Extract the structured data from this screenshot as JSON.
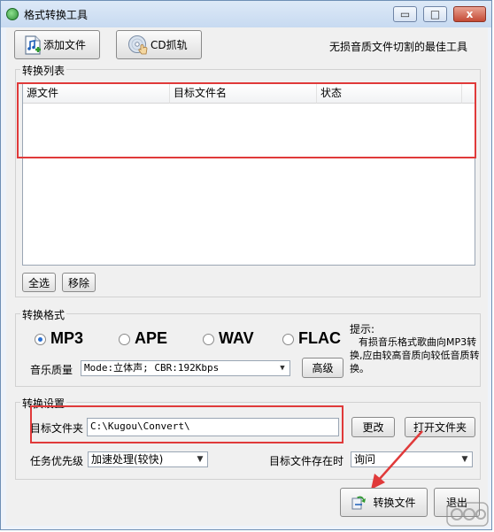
{
  "window": {
    "title": "格式转换工具",
    "min_label": "▭",
    "max_label": "□",
    "close_label": "x"
  },
  "toolbar": {
    "add_file_label": "添加文件",
    "cd_rip_label": "CD抓轨",
    "slogan": "无损音质文件切割的最佳工具"
  },
  "list": {
    "group_label": "转换列表",
    "columns": [
      "源文件",
      "目标文件名",
      "状态"
    ],
    "select_all_label": "全选",
    "remove_label": "移除"
  },
  "format": {
    "group_label": "转换格式",
    "options": [
      "MP3",
      "APE",
      "WAV",
      "FLAC"
    ],
    "selected": "MP3",
    "hint_title": "提示:",
    "hint_body": "有损音乐格式歌曲向MP3转换,应由较高音质向较低音质转换。",
    "quality_label": "音乐质量",
    "quality_value": "Mode:立体声; CBR:192Kbps",
    "advanced_label": "高级"
  },
  "settings": {
    "group_label": "转换设置",
    "target_folder_label": "目标文件夹",
    "target_folder_value": "C:\\Kugou\\Convert\\",
    "change_label": "更改",
    "open_folder_label": "打开文件夹",
    "priority_label": "任务优先级",
    "priority_value": "加速处理(较快)",
    "exists_label": "目标文件存在时",
    "exists_value": "询问"
  },
  "actions": {
    "convert_label": "转换文件",
    "exit_label": "退出"
  },
  "colors": {
    "annotation_red": "#e03a3a",
    "radio_selected": "#2b6fd0"
  }
}
